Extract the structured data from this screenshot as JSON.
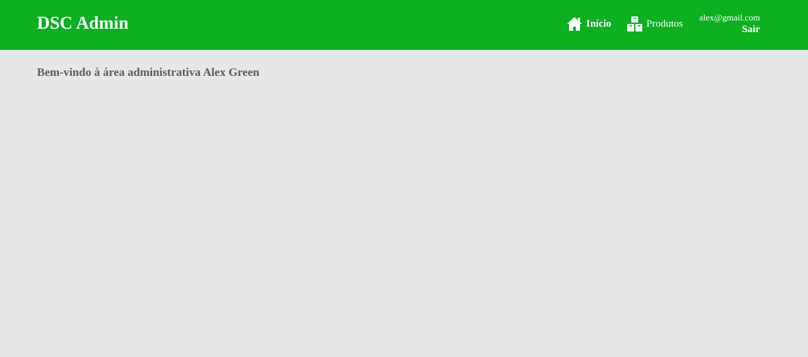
{
  "header": {
    "brand": "DSC Admin",
    "nav": {
      "home_label": "Início",
      "home_icon": "home-icon",
      "products_label": "Produtos",
      "products_icon": "boxes-icon"
    },
    "user": {
      "email": "alex@gmail.com",
      "logout_label": "Sair"
    }
  },
  "main": {
    "welcome": "Bem-vindo à área administrativa Alex Green"
  },
  "colors": {
    "header_bg": "#0cb020",
    "page_bg": "#e7e7e7",
    "text_muted": "#5b5b5b"
  }
}
